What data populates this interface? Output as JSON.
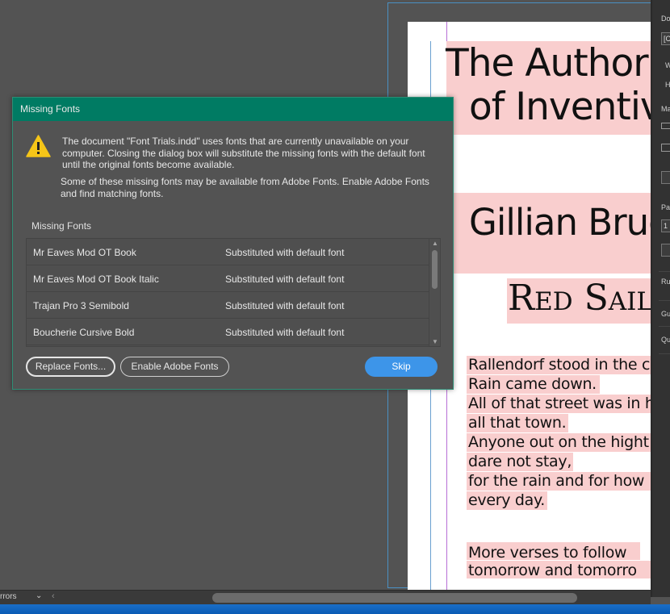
{
  "document_page": {
    "title_lines": [
      "The Author",
      "of Inventiv"
    ],
    "author": "Gillian Brue",
    "book_title": "Red Sails",
    "body_lines": [
      "Rallendorf stood in the c",
      "Rain came down.",
      "All of that street was in h",
      "all that town.",
      "Anyone out on the hight",
      "dare not stay,",
      "for the rain and for how",
      "every day."
    ],
    "verse_lines": [
      "More verses to follow",
      "tomorrow and tomorro"
    ]
  },
  "right_panel": {
    "labels": [
      "Do",
      "[C",
      "W",
      "H",
      "Ma",
      "Pa",
      "1",
      "Ru",
      "Gu",
      "Qu"
    ]
  },
  "status_bar": {
    "errors_label": "rrors",
    "chevron": "⌄",
    "left_arrow": "‹"
  },
  "dialog": {
    "title": "Missing Fonts",
    "message_primary": "The document \"Font Trials.indd\" uses fonts that are currently unavailable on your computer. Closing the dialog box will substitute the missing fonts with the default font until the original fonts become available.",
    "message_secondary": "Some of these missing fonts may be available from Adobe Fonts. Enable Adobe Fonts and find matching fonts.",
    "list_heading": "Missing Fonts",
    "fonts": [
      {
        "name": "Mr Eaves Mod OT Book",
        "status": "Substituted with default font"
      },
      {
        "name": "Mr Eaves Mod OT Book Italic",
        "status": "Substituted with default font"
      },
      {
        "name": "Trajan Pro 3 Semibold",
        "status": "Substituted with default font"
      },
      {
        "name": "Boucherie Cursive Bold",
        "status": "Substituted with default font"
      }
    ],
    "buttons": {
      "replace": "Replace Fonts...",
      "enable": "Enable Adobe Fonts",
      "skip": "Skip"
    }
  },
  "icons": {
    "warning": "warning-icon",
    "scroll_up": "▲",
    "scroll_down": "▼"
  },
  "colors": {
    "dialog_title_bar": "#007b63",
    "primary_button": "#3d95e9",
    "text_highlight": "#f9cece",
    "warning_yellow": "#f5c518"
  }
}
